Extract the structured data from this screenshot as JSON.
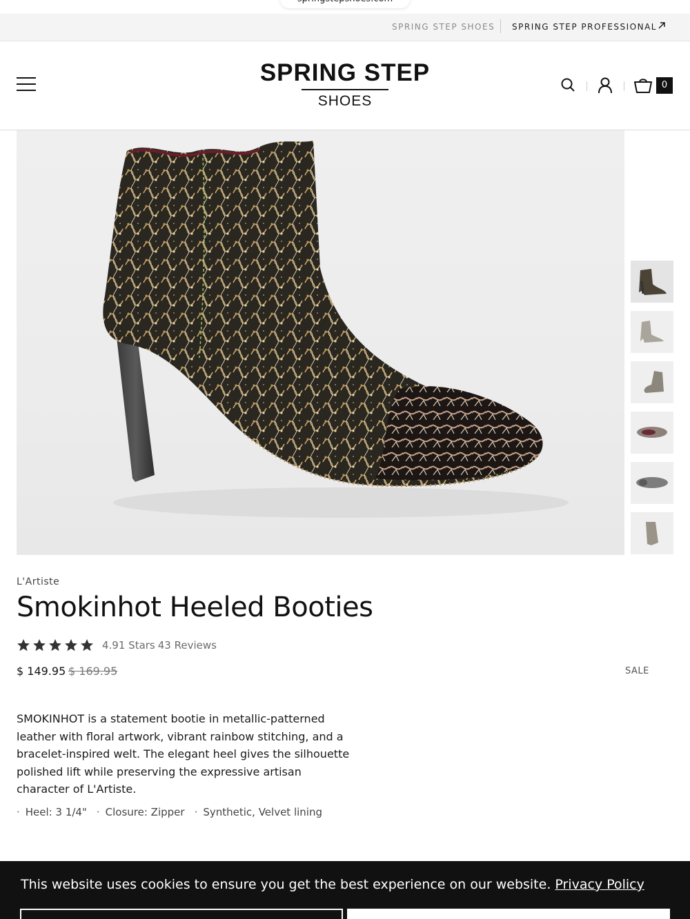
{
  "browser": {
    "url": "springstepshoes.com"
  },
  "top_strip": {
    "link_a": "SPRING STEP SHOES",
    "link_b": "SPRING STEP PROFESSIONAL"
  },
  "header": {
    "logo_main": "SPRING STEP",
    "logo_sub": "SHOES",
    "cart_count": "0"
  },
  "product": {
    "brand": "L'Artiste",
    "title": "Smokinhot Heeled Booties",
    "rating_value": "4.91 Stars",
    "review_count": "43 Reviews",
    "stars": 5,
    "price_current": "$ 149.95",
    "price_original": "$ 169.95",
    "sale_label": "SALE",
    "description": "SMOKINHOT is a statement bootie in metallic-patterned leather with floral artwork, vibrant rainbow stitching, and a bracelet-inspired welt. The elegant heel gives the silhouette polished lift while preserving the expressive artisan character of L'Artiste.",
    "specs": [
      "Heel: 3 1/4\"",
      "Closure: Zipper",
      "Synthetic, Velvet lining"
    ],
    "thumbnail_count": 6
  },
  "cookie_banner": {
    "text": "This website uses cookies to ensure you get the best experience on our website.",
    "link": "Privacy Policy"
  },
  "colors": {
    "accent": "#111111",
    "banner_bg": "#111111",
    "page_bg": "#ffffff"
  }
}
